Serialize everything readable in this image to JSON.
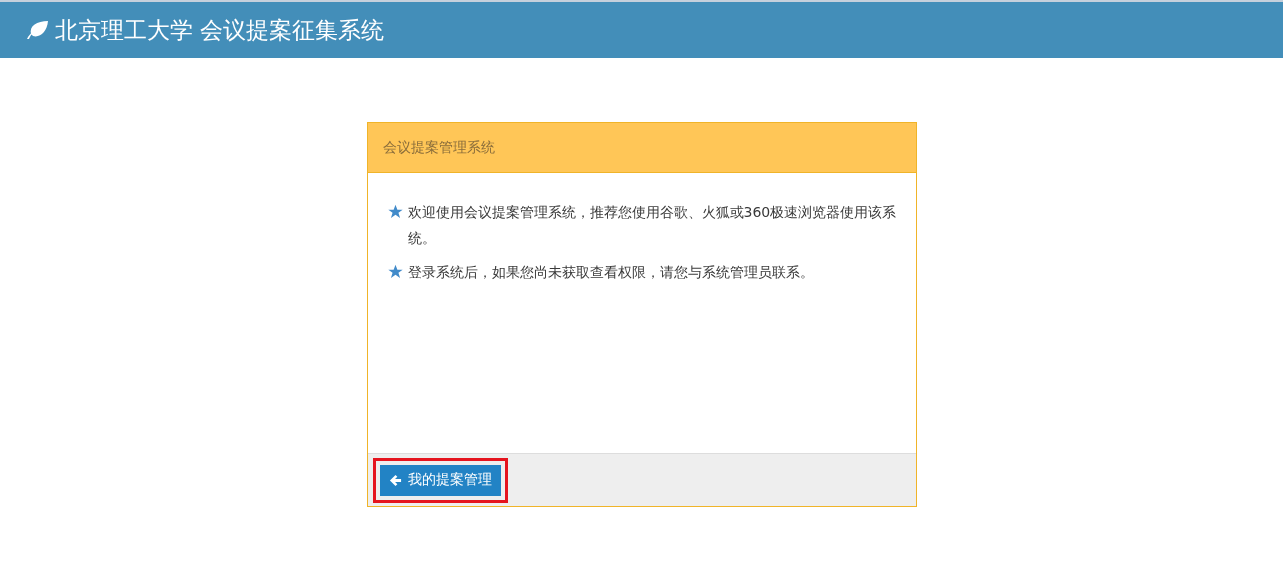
{
  "navbar": {
    "title": "北京理工大学 会议提案征集系统"
  },
  "panel": {
    "heading": "会议提案管理系统",
    "notes": [
      "欢迎使用会议提案管理系统，推荐您使用谷歌、火狐或360极速浏览器使用该系统。",
      "登录系统后，如果您尚未获取查看权限，请您与系统管理员联系。"
    ],
    "footer_button": {
      "label": "我的提案管理",
      "highlighted": true
    }
  }
}
